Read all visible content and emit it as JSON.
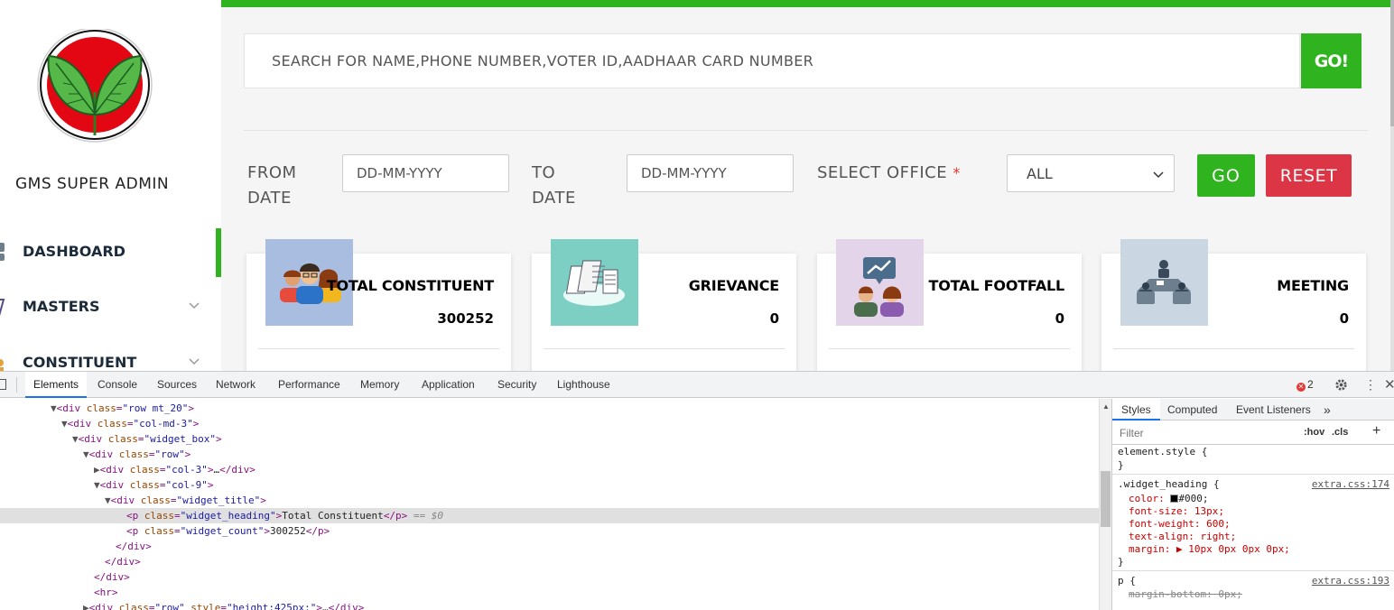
{
  "sidebar": {
    "admin_name": "GMS SUPER ADMIN",
    "items": [
      {
        "label": "DASHBOARD",
        "active": true
      },
      {
        "label": "MASTERS",
        "active": false
      },
      {
        "label": "CONSTITUENT",
        "active": false
      }
    ]
  },
  "search": {
    "placeholder": "SEARCH FOR NAME,PHONE NUMBER,VOTER ID,AADHAAR CARD NUMBER",
    "button_label": "GO!"
  },
  "filters": {
    "from_label_1": "FROM",
    "from_label_2": "DATE",
    "from_placeholder": "DD-MM-YYYY",
    "to_label_1": "TO",
    "to_label_2": "DATE",
    "to_placeholder": "DD-MM-YYYY",
    "office_label": "SELECT OFFICE",
    "required_mark": "*",
    "office_value": "ALL",
    "go_label": "GO",
    "reset_label": "RESET"
  },
  "widgets": [
    {
      "title": "TOTAL CONSTITUENT",
      "count": "300252",
      "icon": "constituent-people-icon",
      "bg": "#a9bde0"
    },
    {
      "title": "GRIEVANCE",
      "count": "0",
      "icon": "grievance-documents-icon",
      "bg": "#7ecfc3"
    },
    {
      "title": "TOTAL FOOTFALL",
      "count": "0",
      "icon": "footfall-chart-people-icon",
      "bg": "#e3d4ea"
    },
    {
      "title": "MEETING",
      "count": "0",
      "icon": "meeting-table-icon",
      "bg": "#cad7e2"
    }
  ],
  "colors": {
    "accent_green": "#2fb31e",
    "reset_red": "#dc3545"
  },
  "devtools": {
    "tabs": [
      "Elements",
      "Console",
      "Sources",
      "Network",
      "Performance",
      "Memory",
      "Application",
      "Security",
      "Lighthouse"
    ],
    "active_tab": "Elements",
    "error_count": "2",
    "styles_tabs": [
      "Styles",
      "Computed",
      "Event Listeners",
      "»"
    ],
    "filter_placeholder": "Filter",
    "hov": ":hov",
    "cls": ".cls",
    "dom_lines": [
      "▼<div class=\"row mt_20\">",
      "▼<div class=\"col-md-3\">",
      "▼<div class=\"widget_box\">",
      "▼<div class=\"row\">",
      "▶<div class=\"col-3\">…</div>",
      "▼<div class=\"col-9\">",
      "▼<div class=\"widget_title\">",
      "<p class=\"widget_heading\">Total Constituent</p> == $0",
      "<p class=\"widget_count\">300252</p>",
      "</div>",
      "</div>",
      "</div>",
      "<hr>",
      "▶<div class=\"row\" style=\"height:425px;\">…</div>"
    ],
    "styles": {
      "element_style": "element.style {",
      "close": "}",
      "rule1_selector": ".widget_heading {",
      "rule1_source": "extra.css:174",
      "rule1_props": [
        "color: ",
        "#000;",
        "font-size: 13px;",
        "font-weight: 600;",
        "text-align: right;",
        "margin: ▶ 10px 0px 0px 0px;"
      ],
      "rule2_selector": "p {",
      "rule2_source": "extra.css:193",
      "rule2_prop": "margin-bottom: 0px;"
    }
  }
}
